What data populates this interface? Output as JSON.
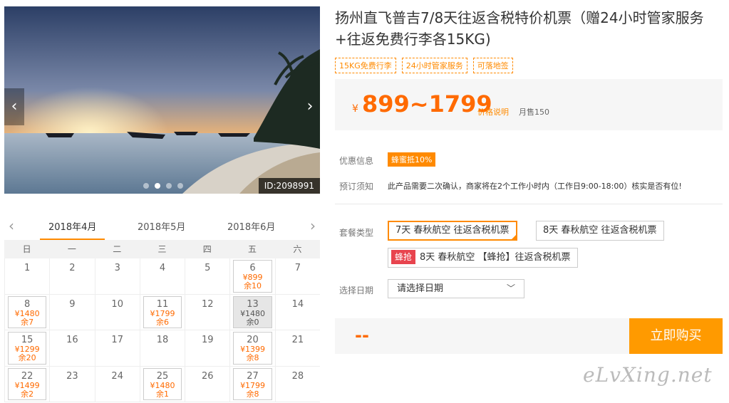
{
  "photo": {
    "id_label": "ID:2098991",
    "prev": "‹",
    "next": "›",
    "slide_count": 4,
    "active_slide": 1
  },
  "calendar": {
    "prev": "‹",
    "next": "›",
    "months": [
      "2018年4月",
      "2018年5月",
      "2018年6月"
    ],
    "active_month": 0,
    "weekdays": [
      "日",
      "一",
      "二",
      "三",
      "四",
      "五",
      "六"
    ],
    "days": [
      {
        "d": "1"
      },
      {
        "d": "2"
      },
      {
        "d": "3"
      },
      {
        "d": "4"
      },
      {
        "d": "5"
      },
      {
        "d": "6",
        "price": "¥899",
        "rem": "余10"
      },
      {
        "d": "7"
      },
      {
        "d": "8",
        "price": "¥1480",
        "rem": "余7"
      },
      {
        "d": "9"
      },
      {
        "d": "10"
      },
      {
        "d": "11",
        "price": "¥1799",
        "rem": "余6"
      },
      {
        "d": "12"
      },
      {
        "d": "13",
        "price": "¥1480",
        "rem": "余0",
        "soldout": true
      },
      {
        "d": "14"
      },
      {
        "d": "15",
        "price": "¥1299",
        "rem": "余20"
      },
      {
        "d": "16"
      },
      {
        "d": "17"
      },
      {
        "d": "18"
      },
      {
        "d": "19"
      },
      {
        "d": "20",
        "price": "¥1399",
        "rem": "余8"
      },
      {
        "d": "21"
      },
      {
        "d": "22",
        "price": "¥1499",
        "rem": "余2"
      },
      {
        "d": "23"
      },
      {
        "d": "24"
      },
      {
        "d": "25",
        "price": "¥1480",
        "rem": "余1"
      },
      {
        "d": "26"
      },
      {
        "d": "27",
        "price": "¥1799",
        "rem": "余8"
      },
      {
        "d": "28"
      }
    ]
  },
  "product": {
    "title": "扬州直飞普吉7/8天往返含税特价机票（赠24小时管家服务+往返免费行李各15KG)",
    "tags": [
      "15KG免费行李",
      "24小时管家服务",
      "可落地签"
    ],
    "currency": "¥",
    "price_range": "899~1799",
    "price_explain": "价格说明",
    "monthly_sales": "月售150"
  },
  "offers": {
    "promo_label": "优惠信息",
    "promo_badge": "蜂蜜抵10%",
    "notice_label": "预订须知",
    "notice_text": "此产品需要二次确认，商家将在2个工作小时内（工作日9:00-18:00）核实是否有位!"
  },
  "packages": {
    "label": "套餐类型",
    "options": [
      "7天 春秋航空 往返含税机票",
      "8天 春秋航空 往返含税机票",
      "8天 春秋航空 【蜂抢】往返含税机票"
    ],
    "flash_badge": "蜂抢"
  },
  "date_picker": {
    "label": "选择日期",
    "placeholder": "请选择日期",
    "chevron": "﹀"
  },
  "buy": {
    "total": "--",
    "button": "立即购买"
  },
  "watermark": "eLvXing.net"
}
